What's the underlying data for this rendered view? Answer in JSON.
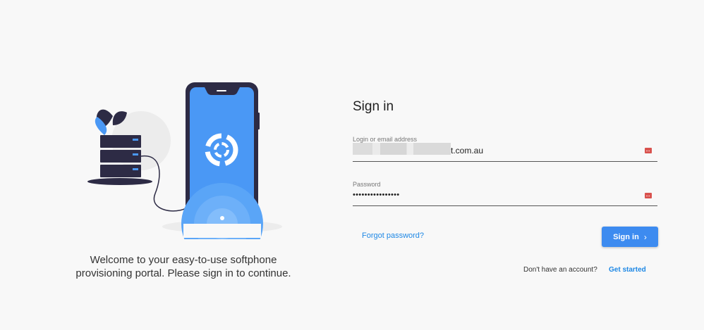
{
  "welcome": {
    "line1": "Welcome to your easy-to-use softphone",
    "line2": "provisioning portal. Please sign in to continue."
  },
  "illustration": {
    "phone_icon": "softphone-logo-icon",
    "server_icon": "server-rack-icon"
  },
  "signin": {
    "title": "Sign in",
    "login": {
      "label": "Login or email address",
      "value_visible_suffix": "t.com.au",
      "value_redacted": true,
      "key_icon": "password-manager-icon"
    },
    "password": {
      "label": "Password",
      "value": "••••••••••••••••",
      "key_icon": "password-manager-icon"
    },
    "forgot_label": "Forgot password?",
    "button_label": "Sign in",
    "button_icon": "chevron-right-icon",
    "no_account_text": "Don't have an account?",
    "get_started_label": "Get started"
  },
  "colors": {
    "accent": "#3d8bf0",
    "link": "#1e88e5",
    "phone_screen": "#4a98f5",
    "phone_body": "#2d2b45",
    "key_icon": "#d9534f",
    "background": "#f8f8f8"
  }
}
